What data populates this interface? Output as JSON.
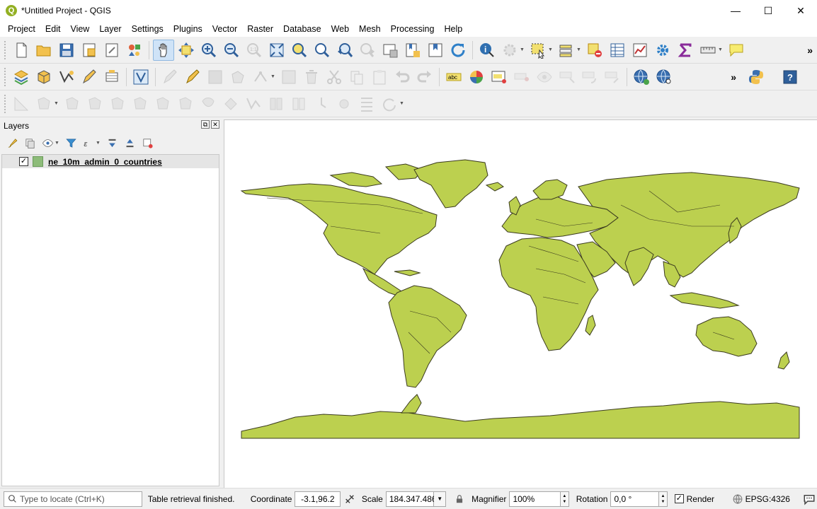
{
  "window": {
    "title": "*Untitled Project - QGIS",
    "app_icon_letter": "Q"
  },
  "menu": [
    "Project",
    "Edit",
    "View",
    "Layer",
    "Settings",
    "Plugins",
    "Vector",
    "Raster",
    "Database",
    "Web",
    "Mesh",
    "Processing",
    "Help"
  ],
  "layers_panel": {
    "title": "Layers",
    "layer": {
      "name": "ne_10m_admin_0_countries",
      "checked": "✓",
      "fill_color": "#8dbc79"
    }
  },
  "map": {
    "fill_color": "#bcd04f",
    "stroke_color": "#3b3b1f",
    "background": "#ffffff"
  },
  "status": {
    "locator_placeholder": "Type to locate (Ctrl+K)",
    "message": "Table retrieval finished.",
    "coordinate_label": "Coordinate",
    "coordinate_value": "-3.1,96.2",
    "scale_label": "Scale",
    "scale_value": "184.347.486",
    "magnifier_label": "Magnifier",
    "magnifier_value": "100%",
    "rotation_label": "Rotation",
    "rotation_value": "0,0 °",
    "render_label": "Render",
    "render_checked": "✓",
    "crs": "EPSG:4326"
  }
}
